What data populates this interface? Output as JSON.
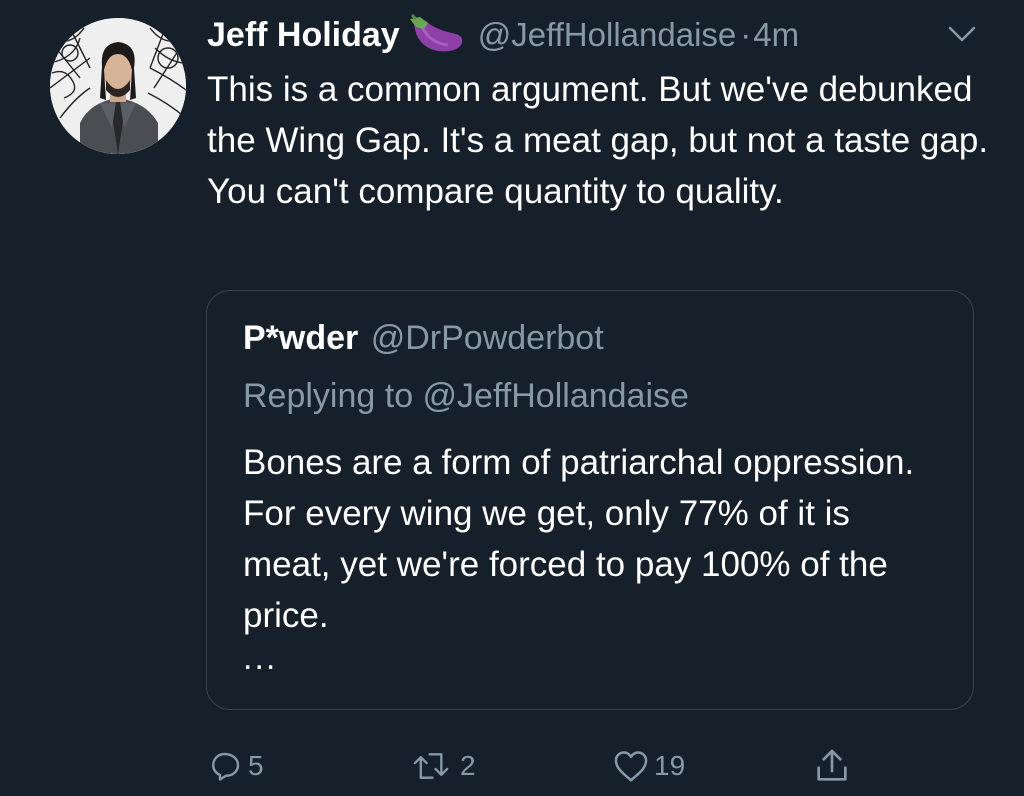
{
  "tweet": {
    "author_name": "Jeff Holiday",
    "author_emoji": "eggplant-emoji",
    "author_handle": "@JeffHollandaise",
    "separator": "·",
    "time": "4m",
    "text": "This is a common argument. But we've debunked the Wing Gap. It's a meat gap, but not a taste gap. You can't compare quantity to quality."
  },
  "quote": {
    "author_name": "P*wder",
    "author_handle": "@DrPowderbot",
    "replying_to": "Replying to @JeffHollandaise",
    "text": "Bones are a form of patriarchal oppression. For every wing we get, only 77% of it is meat, yet we're forced to pay 100% of the price.",
    "more": "..."
  },
  "actions": {
    "reply_count": "5",
    "retweet_count": "2",
    "like_count": "19"
  },
  "colors": {
    "background": "#15202b",
    "text_primary": "#ffffff",
    "text_secondary": "#8899a6",
    "border": "#38444d"
  }
}
